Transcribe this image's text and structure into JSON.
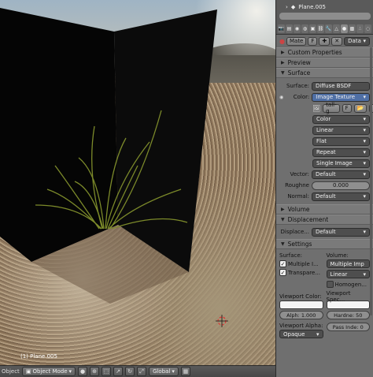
{
  "viewport": {
    "status": "(1) Plane.005"
  },
  "header": {
    "mode_prefix": "Object",
    "object_mode": "Object Mode",
    "orientation": "Global"
  },
  "panel": {
    "breadcrumb": "Plane.005",
    "material_slot": "Mate",
    "fake_user": "F",
    "data_label": "Data",
    "sections": {
      "custom_properties": "Custom Properties",
      "preview": "Preview",
      "surface": "Surface",
      "volume": "Volume",
      "displacement": "Displacement",
      "settings": "Settings"
    },
    "surface": {
      "label": "Surface:",
      "value": "Diffuse BSDF"
    },
    "color": {
      "label": "Color:",
      "value": "Image Texture"
    },
    "texture": {
      "name": "tall-g",
      "fake_user": "F",
      "color_space": "Color",
      "interpolation": "Linear",
      "projection": "Flat",
      "extension": "Repeat",
      "source": "Single Image"
    },
    "vector": {
      "label": "Vector:",
      "value": "Default"
    },
    "roughness": {
      "label": "Roughne",
      "value": "0.000"
    },
    "normal": {
      "label": "Normal:",
      "value": "Default"
    },
    "displacement": {
      "label": "Displace...",
      "value": "Default"
    },
    "settings": {
      "surface_head": "Surface:",
      "volume_head": "Volume:",
      "multiple_importance": "Multiple I...",
      "transparent_shadows": "Transpare...",
      "volume_sampling": "Multiple Imp",
      "volume_interpolation": "Linear",
      "homogeneous": "Homogen..."
    },
    "viewport_color": {
      "label": "Viewport Color:",
      "alpha": "Alph: 1.000"
    },
    "viewport_specular": {
      "label": "Viewport Spec...",
      "hardness": "Hardne: 50"
    },
    "viewport_alpha": {
      "label": "Viewport Alpha:",
      "value": "Opaque"
    },
    "pass_index": "Pass Inde: 0"
  },
  "colors": {
    "panel_bg": "#6f6f6f",
    "accent_blue": "#4f6fa5"
  }
}
